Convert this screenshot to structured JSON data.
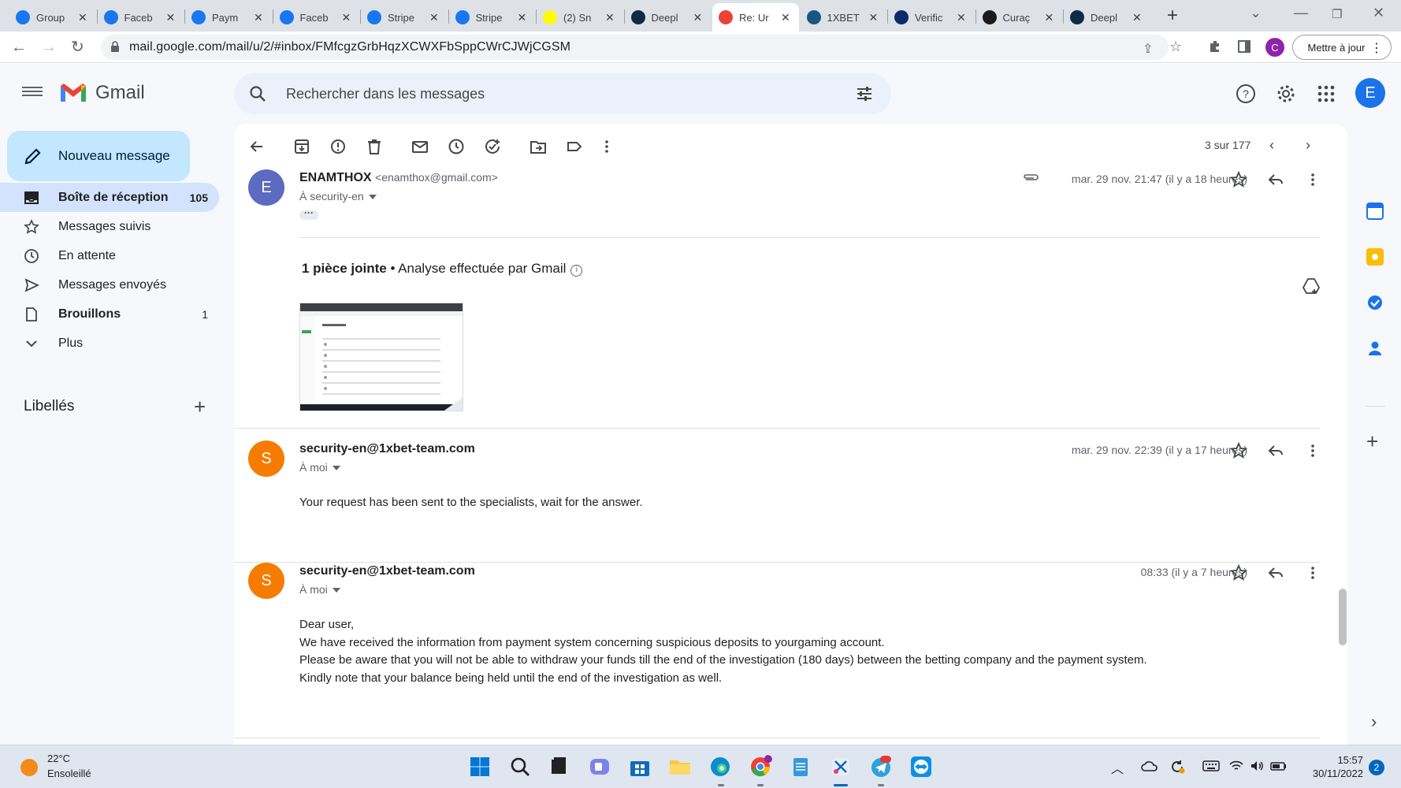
{
  "browser": {
    "tabs": [
      {
        "icon": "facebook-icon",
        "title": "Group",
        "color": "#1877f2"
      },
      {
        "icon": "facebook-icon",
        "title": "Faceb",
        "color": "#1877f2"
      },
      {
        "icon": "facebook-icon",
        "title": "Paym",
        "color": "#1877f2"
      },
      {
        "icon": "facebook-icon",
        "title": "Faceb",
        "color": "#1877f2"
      },
      {
        "icon": "facebook-icon",
        "title": "Stripe",
        "color": "#1877f2"
      },
      {
        "icon": "facebook-icon",
        "title": "Stripe",
        "color": "#1877f2"
      },
      {
        "icon": "snapchat-icon",
        "title": "(2) Sn",
        "color": "#fffc00"
      },
      {
        "icon": "deepl-icon",
        "title": "Deepl",
        "color": "#0f2b46"
      },
      {
        "icon": "gmail-icon",
        "title": "Re: Ur",
        "color": "#ea4335",
        "active": true
      },
      {
        "icon": "1xbet-icon",
        "title": "1XBET",
        "color": "#1a5683"
      },
      {
        "icon": "shield-icon",
        "title": "Verific",
        "color": "#0d2a6b"
      },
      {
        "icon": "shield-icon",
        "title": "Curaç",
        "color": "#1b1b1b"
      },
      {
        "icon": "deepl-icon",
        "title": "Deepl",
        "color": "#0f2b46"
      }
    ],
    "url": "mail.google.com/mail/u/2/#inbox/FMfcgzGrbHqzXCWXFbSppCWrCJWjCGSM",
    "profile_letter": "C",
    "update_button": "Mettre à jour"
  },
  "gmail": {
    "logo_text": "Gmail",
    "search_placeholder": "Rechercher dans les messages",
    "account_letter": "E",
    "compose_label": "Nouveau message",
    "nav": [
      {
        "icon": "inbox-icon",
        "label": "Boîte de réception",
        "count": "105",
        "active": true
      },
      {
        "icon": "star-icon",
        "label": "Messages suivis",
        "count": ""
      },
      {
        "icon": "clock-icon",
        "label": "En attente",
        "count": ""
      },
      {
        "icon": "send-icon",
        "label": "Messages envoyés",
        "count": ""
      },
      {
        "icon": "draft-icon",
        "label": "Brouillons",
        "count": "1",
        "bold": true
      },
      {
        "icon": "chevron-down-icon",
        "label": "Plus",
        "count": ""
      }
    ],
    "labels_title": "Libellés",
    "pager": "3 sur 177",
    "messages": [
      {
        "avatar": "E",
        "avatar_color": "#5c6bc0",
        "from": "ENAMTHOX",
        "email": "<enamthox@gmail.com>",
        "to": "À security-en",
        "date": "mar. 29 nov. 21:47 (il y a 18 heures)",
        "attachment_count": "1 pièce jointe",
        "attachment_scan": "• Analyse effectuée par Gmail"
      },
      {
        "avatar": "S",
        "avatar_color": "#f57c00",
        "from": "security-en@1xbet-team.com",
        "to": "À moi",
        "date": "mar. 29 nov. 22:39 (il y a 17 heures)",
        "body": [
          "Your request has been sent to the specialists, wait for the answer."
        ]
      },
      {
        "avatar": "S",
        "avatar_color": "#f57c00",
        "from": "security-en@1xbet-team.com",
        "to": "À moi",
        "date": "08:33 (il y a 7 heures)",
        "body": [
          "Dear user,",
          "We have received the information from payment system concerning suspicious deposits to yourgaming account.",
          "Please be aware that you will not be able to withdraw your funds till the end of the investigation (180 days) between the betting company and the payment system.",
          "Kindly note that your balance being held until the end of the investigation as well."
        ]
      }
    ]
  },
  "taskbar": {
    "temperature": "22°C",
    "condition": "Ensoleillé",
    "time": "15:57",
    "date": "30/11/2022",
    "notifications": "2"
  }
}
